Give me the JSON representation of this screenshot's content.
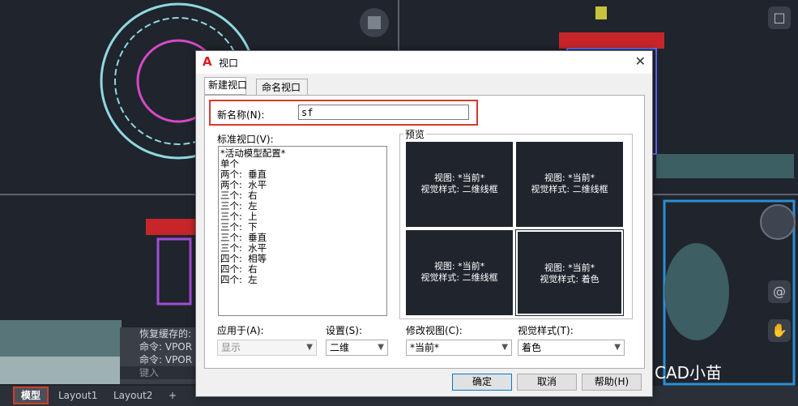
{
  "dialog": {
    "title": "视口",
    "tabs": [
      "新建视口",
      "命名视口"
    ],
    "new_name_label": "新名称(N):",
    "new_name_value": "sf",
    "standard_label": "标准视口(V):",
    "standard_items": [
      "*活动模型配置*",
      "单个",
      "两个:  垂直",
      "两个:  水平",
      "三个:  右",
      "三个:  左",
      "三个:  上",
      "三个:  下",
      "三个:  垂直",
      "三个:  水平",
      "四个:  相等",
      "四个:  右",
      "四个:  左"
    ],
    "preview_label": "预览",
    "preview_cells": [
      {
        "view": "视图: *当前*",
        "style": "视觉样式: 二维线框"
      },
      {
        "view": "视图: *当前*",
        "style": "视觉样式: 二维线框"
      },
      {
        "view": "视图: *当前*",
        "style": "视觉样式: 二维线框"
      },
      {
        "view": "视图: *当前*",
        "style": "视觉样式: 着色"
      }
    ],
    "apply_label": "应用于(A):",
    "apply_value": "显示",
    "setup_label": "设置(S):",
    "setup_value": "二维",
    "change_view_label": "修改视图(C):",
    "change_view_value": "*当前*",
    "visual_style_label": "视觉样式(T):",
    "visual_style_value": "着色",
    "ok": "确定",
    "cancel": "取消",
    "help": "帮助(H)"
  },
  "command": {
    "lines": [
      "恢复缓存的:",
      "命令: VPOR",
      "命令: VPOR"
    ],
    "input_placeholder": "键入"
  },
  "layout_tabs": [
    "模型",
    "Layout1",
    "Layout2",
    "+"
  ],
  "watermark": "CAD小苗",
  "colors": {
    "highlight": "#d63a2e",
    "viewport_bg": "#20252d",
    "cad_bg": "#20242c"
  }
}
